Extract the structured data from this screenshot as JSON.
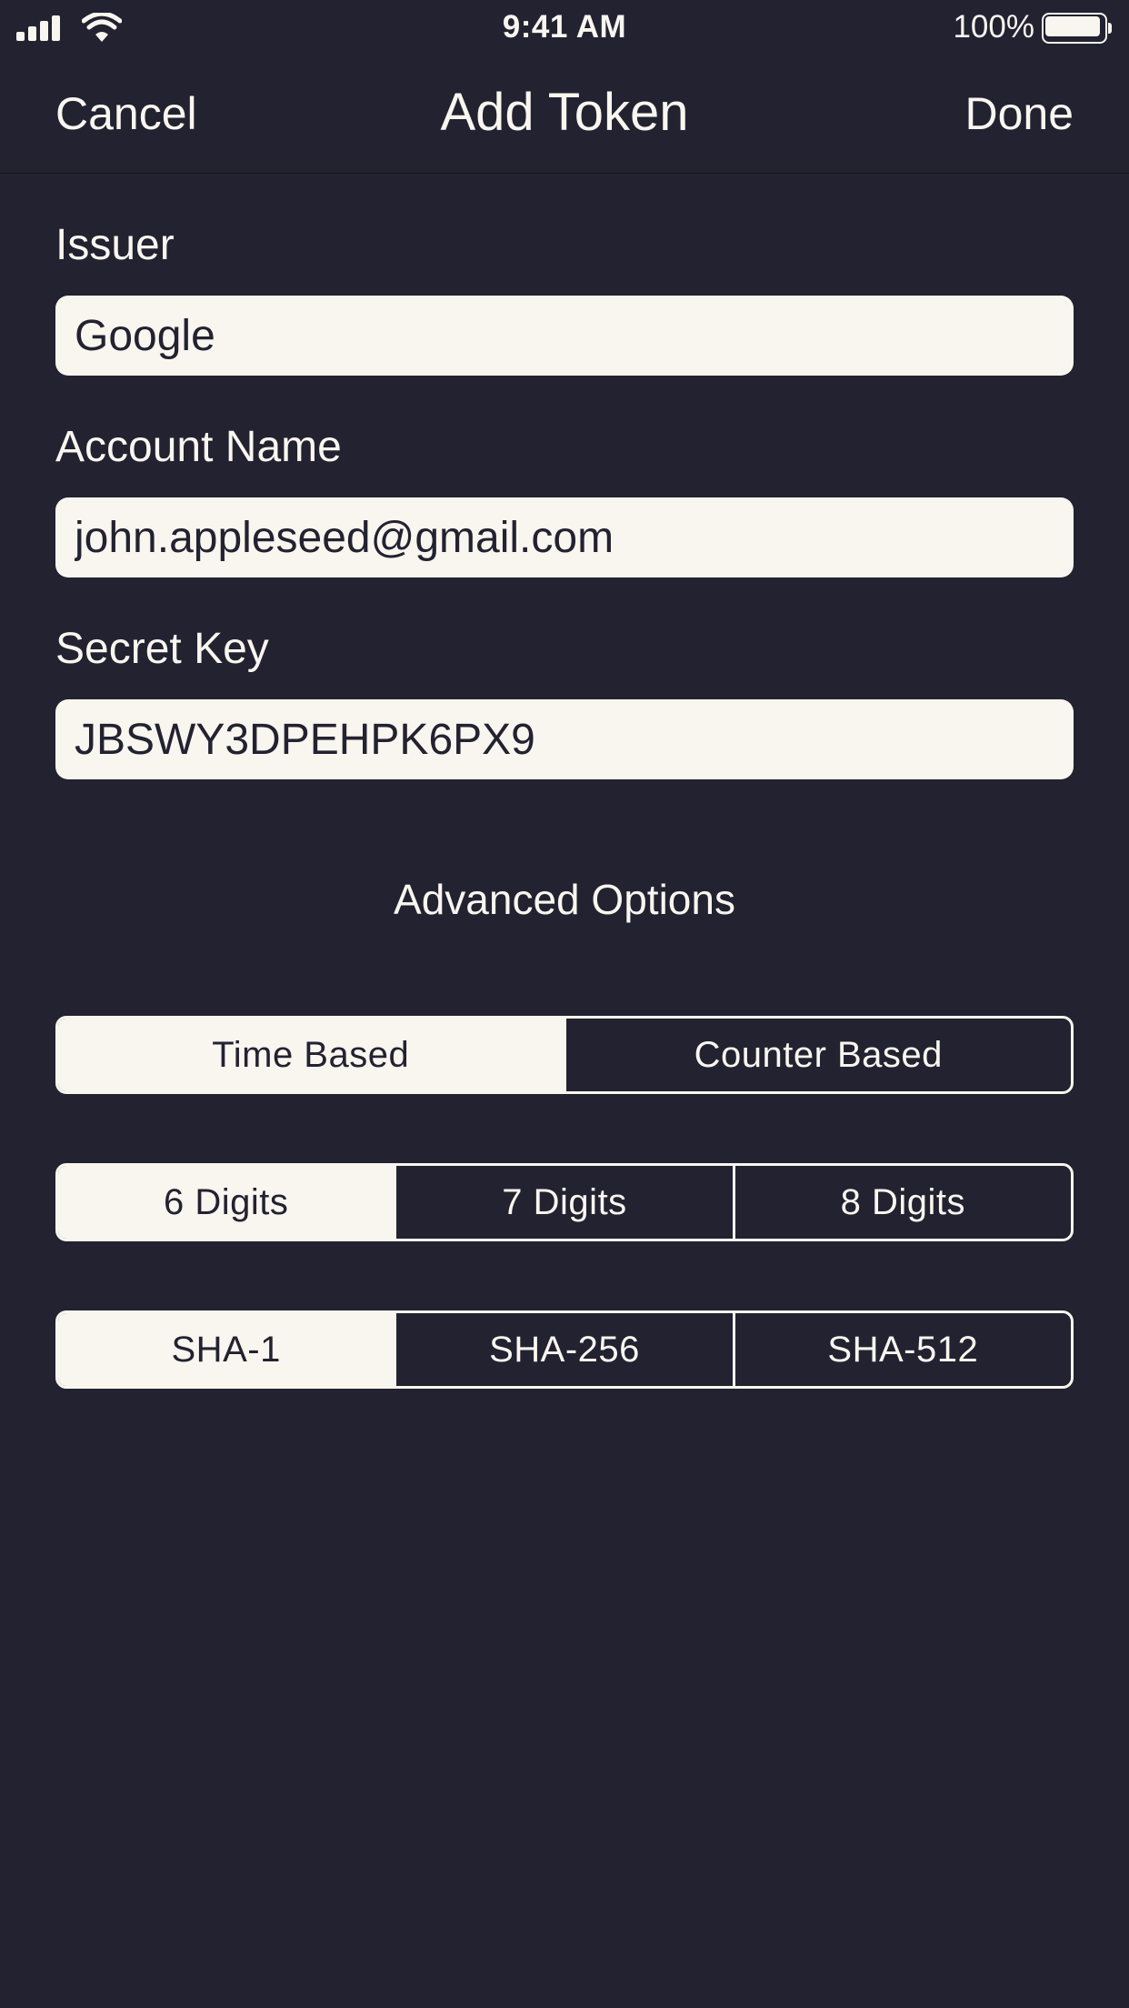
{
  "status_bar": {
    "time": "9:41 AM",
    "battery_percent": "100%",
    "battery_level": 1.0,
    "icons": [
      "signal-icon",
      "wifi-icon",
      "battery-icon"
    ]
  },
  "nav": {
    "cancel_label": "Cancel",
    "title": "Add Token",
    "done_label": "Done"
  },
  "form": {
    "issuer": {
      "label": "Issuer",
      "value": "Google"
    },
    "account": {
      "label": "Account Name",
      "value": "john.appleseed@gmail.com"
    },
    "secret": {
      "label": "Secret Key",
      "value": "JBSWY3DPEHPK6PX9"
    }
  },
  "advanced": {
    "title": "Advanced Options",
    "token_type": {
      "options": [
        "Time Based",
        "Counter Based"
      ],
      "selected": "Time Based"
    },
    "digits": {
      "options": [
        "6 Digits",
        "7 Digits",
        "8 Digits"
      ],
      "selected": "6 Digits"
    },
    "algorithm": {
      "options": [
        "SHA-1",
        "SHA-256",
        "SHA-512"
      ],
      "selected": "SHA-1"
    }
  },
  "colors": {
    "background": "#232230",
    "foreground": "#f9f6f0"
  }
}
